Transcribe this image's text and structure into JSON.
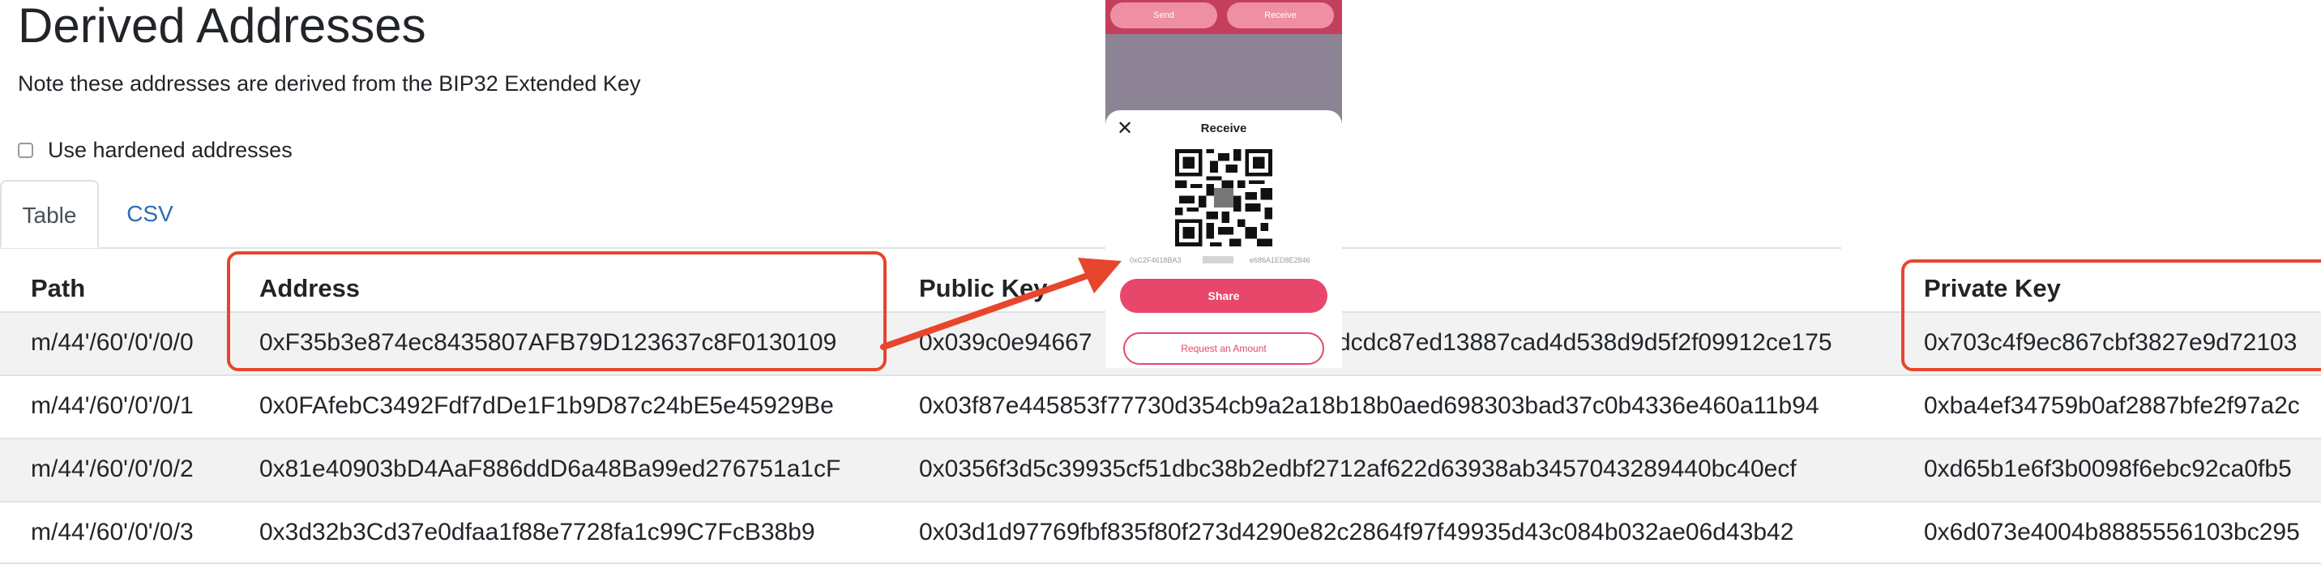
{
  "page": {
    "title": "Derived Addresses",
    "note": "Note these addresses are derived from the BIP32 Extended Key",
    "hardened_label": "Use hardened addresses",
    "hardened_checked": false
  },
  "tabs": [
    {
      "label": "Table",
      "active": true
    },
    {
      "label": "CSV",
      "active": false
    }
  ],
  "table": {
    "columns": [
      "Path",
      "Address",
      "Public Key",
      "Private Key"
    ],
    "rows": [
      {
        "path": "m/44'/60'/0'/0/0",
        "address": "0xF35b3e874ec8435807AFB79D123637c8F0130109",
        "public_key": "0x039c0e94667",
        "public_key_tail": "dcdc87ed13887cad4d538d9d5f2f09912ce175",
        "private_key": "0x703c4f9ec867cbf3827e9d72103"
      },
      {
        "path": "m/44'/60'/0'/0/1",
        "address": "0x0FAfebC3492Fdf7dDe1F1b9D87c24bE5e45929Be",
        "public_key": "0x03f87e445853f77730d354cb9a2a18b18b0aed698303bad37c0b4336e460a11b94",
        "private_key": "0xba4ef34759b0af2887bfe2f97a2c"
      },
      {
        "path": "m/44'/60'/0'/0/2",
        "address": "0x81e40903bD4AaF886ddD6a48Ba99ed276751a1cF",
        "public_key": "0x0356f3d5c39935cf51dbc38b2edbf2712af622d63938ab3457043289440bc40ecf",
        "private_key": "0xd65b1e6f3b0098f6ebc92ca0fb5"
      },
      {
        "path": "m/44'/60'/0'/0/3",
        "address": "0x3d32b3Cd37e0dfaa1f88e7728fa1c99C7FcB38b9",
        "public_key": "0x03d1d97769fbf835f80f273d4290e82c2864f97f49935d43c084b032ae06d43b42",
        "private_key": "0x6d073e4004b8885556103bc295"
      }
    ]
  },
  "phone": {
    "send_label": "Send",
    "receive_tab_label": "Receive",
    "sheet_title": "Receive",
    "close_glyph": "✕",
    "address_left": "0xC2F4618BA3",
    "address_right": "e686A1ED8E2846",
    "share_label": "Share",
    "request_label": "Request an Amount"
  },
  "colors": {
    "highlight": "#e8452d",
    "share_button": "#e8466b",
    "phone_header": "#c43f5c",
    "link": "#2a6db5"
  }
}
